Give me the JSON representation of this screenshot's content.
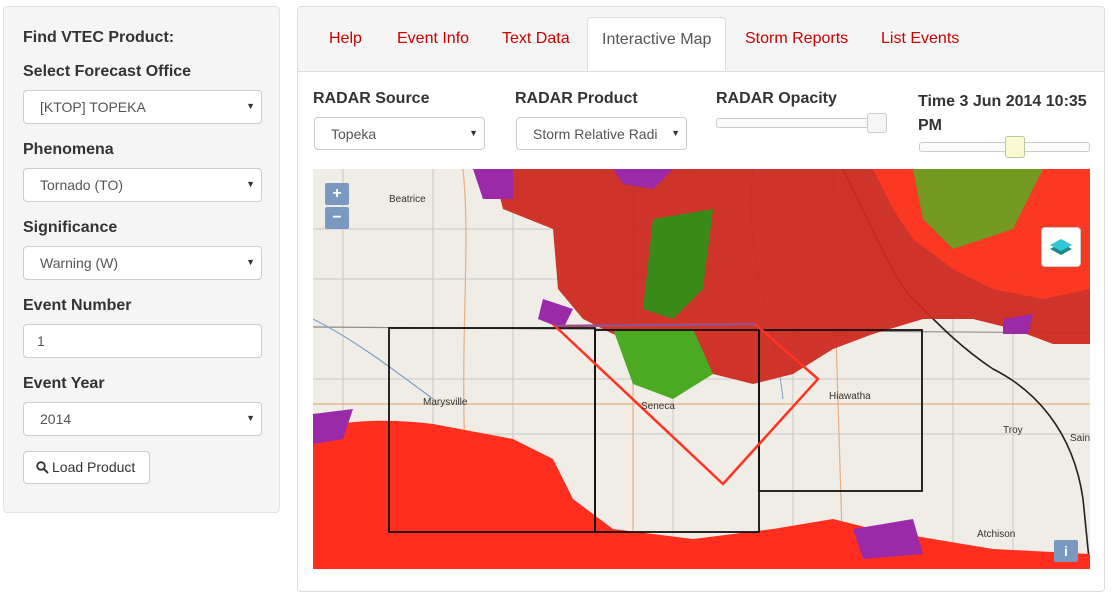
{
  "sidebar": {
    "title": "Find VTEC Product:",
    "office_label": "Select Forecast Office",
    "office_value": "[KTOP] TOPEKA",
    "phenomena_label": "Phenomena",
    "phenomena_value": "Tornado (TO)",
    "significance_label": "Significance",
    "significance_value": "Warning (W)",
    "event_number_label": "Event Number",
    "event_number_value": "1",
    "event_year_label": "Event Year",
    "event_year_value": "2014",
    "load_button": "Load Product"
  },
  "tabs": [
    "Help",
    "Event Info",
    "Text Data",
    "Interactive Map",
    "Storm Reports",
    "List Events"
  ],
  "active_tab": "Interactive Map",
  "controls": {
    "radar_source_label": "RADAR Source",
    "radar_source_value": "Topeka",
    "radar_product_label": "RADAR Product",
    "radar_product_value": "Storm Relative Radi",
    "radar_opacity_label": "RADAR Opacity",
    "radar_opacity_fraction": 1.0,
    "time_label": "Time 3 Jun 2014 10:35 PM",
    "time_slider_fraction": 0.57
  },
  "map": {
    "zoom_in": "+",
    "zoom_out": "−",
    "info": "i",
    "cities": [
      "Beatrice",
      "Marysville",
      "Seneca",
      "Hiawatha",
      "Troy",
      "Atchison",
      "Sain"
    ]
  },
  "colors": {
    "tab_link": "#cc0000",
    "warning_polygon": "#ff3322",
    "radar_red": "#d82a20",
    "radar_green": "#3c9a1a",
    "radar_purple": "#9a2aa8"
  }
}
